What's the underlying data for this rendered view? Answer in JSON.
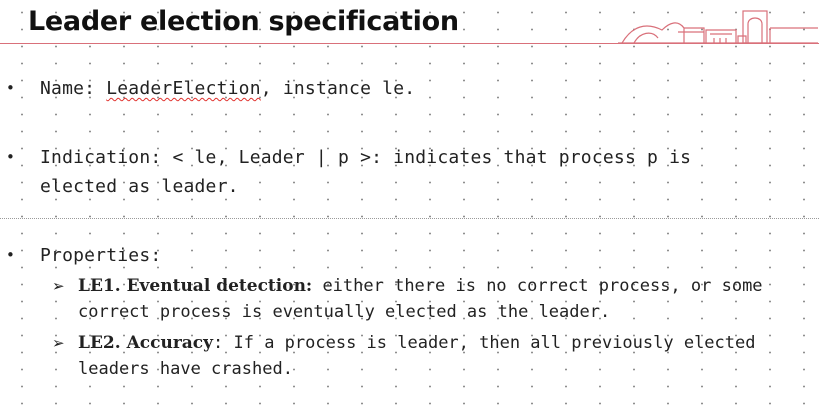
{
  "slide": {
    "title": "Leader election specification",
    "colors": {
      "accent": "#d9707a",
      "text": "#222222",
      "title": "#111111",
      "spellcheck": "#e0302c"
    },
    "bullets": [
      {
        "symbol": "•",
        "prefix": "Name: ",
        "highlight": "LeaderElection",
        "suffix": ", instance le."
      },
      {
        "symbol": "•",
        "lines": [
          "Indication: < le, Leader | p >: indicates that process p is",
          "elected as leader."
        ]
      },
      {
        "symbol": "•",
        "label": "Properties:",
        "sub_items": [
          {
            "symbol": "➢",
            "term": "LE1. Eventual detection:",
            "line1": " either there is no correct process, or some",
            "line2": "correct process is eventually elected as the leader."
          },
          {
            "symbol": "➢",
            "term": "LE2. Accuracy",
            "line1": ": If a process is leader, then all previously elected",
            "line2": "leaders have crashed."
          }
        ]
      }
    ]
  }
}
